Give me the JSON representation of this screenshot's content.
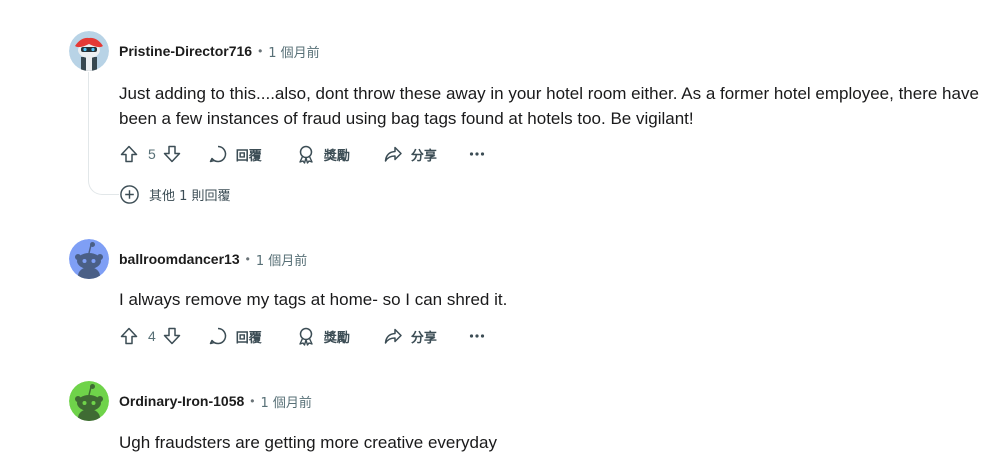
{
  "comments": [
    {
      "username": "Pristine-Director716",
      "separator": "•",
      "time": "1 個月前",
      "body": "Just adding to this....also, dont throw these away in your hotel room either. As a former hotel employee, there have been a few instances of fraud using bag tags found at hotels too. Be vigilant!",
      "votes": "5",
      "reply_label": "回覆",
      "award_label": "獎勵",
      "share_label": "分享",
      "more_replies": "其他 1 則回覆",
      "avatar_colors": {
        "bg": "#b8d3e6",
        "accent": "#e53935"
      }
    },
    {
      "username": "ballroomdancer13",
      "separator": "•",
      "time": "1 個月前",
      "body": "I always remove my tags at home- so I can shred it.",
      "votes": "4",
      "reply_label": "回覆",
      "award_label": "獎勵",
      "share_label": "分享",
      "avatar_colors": {
        "bg": "#7f9ff5",
        "accent": "#4a5f86"
      }
    },
    {
      "username": "Ordinary-Iron-1058",
      "separator": "•",
      "time": "1 個月前",
      "body": "Ugh fraudsters are getting more creative everyday",
      "avatar_colors": {
        "bg": "#6fd34a",
        "accent": "#3f6b33"
      }
    }
  ],
  "icons": {
    "upvote": "arrow-up-outline",
    "downvote": "arrow-down-outline",
    "reply": "speech-bubble",
    "award": "award-ribbon",
    "share": "share-arrow",
    "more": "ellipsis",
    "expand": "plus-circle"
  }
}
